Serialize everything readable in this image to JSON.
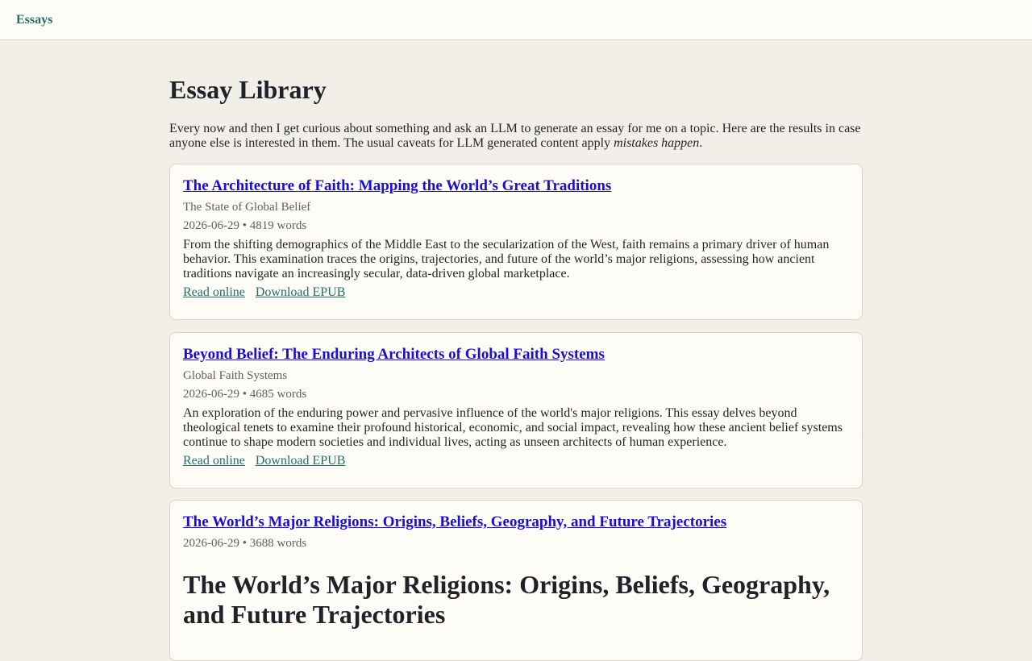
{
  "header": {
    "brand": "Essays"
  },
  "page": {
    "title": "Essay Library",
    "intro_text": "Every now and then I get curious about something and ask an LLM to generate an essay for me on a topic. Here are the results in case anyone else is interested in them. The usual caveats for LLM generated content apply ",
    "intro_emphasis": "mistakes happen",
    "intro_end": "."
  },
  "essays": [
    {
      "title": "The Architecture of Faith: Mapping the World’s Great Traditions",
      "subtitle": "The State of Global Belief",
      "meta": "2026-06-29 • 4819 words",
      "summary": "From the shifting demographics of the Middle East to the secularization of the West, faith remains a primary driver of human behavior. This examination traces the origins, trajectories, and future of the world’s major religions, assessing how ancient traditions navigate an increasingly secular, data-driven global marketplace.",
      "read_label": "Read online",
      "download_label": "Download EPUB"
    },
    {
      "title": "Beyond Belief: The Enduring Architects of Global Faith Systems",
      "subtitle": "Global Faith Systems",
      "meta": "2026-06-29 • 4685 words",
      "summary": "An exploration of the enduring power and pervasive influence of the world's major religions. This essay delves beyond theological tenets to examine their profound historical, economic, and social impact, revealing how these ancient belief systems continue to shape modern societies and individual lives, acting as unseen architects of human experience.",
      "read_label": "Read online",
      "download_label": "Download EPUB"
    },
    {
      "title": "The World’s Major Religions: Origins, Beliefs, Geography, and Future Trajectories",
      "meta": "2026-06-29 • 3688 words",
      "heading": "The World’s Major Religions: Origins, Beliefs, Geography, and Future Trajectories"
    }
  ]
}
